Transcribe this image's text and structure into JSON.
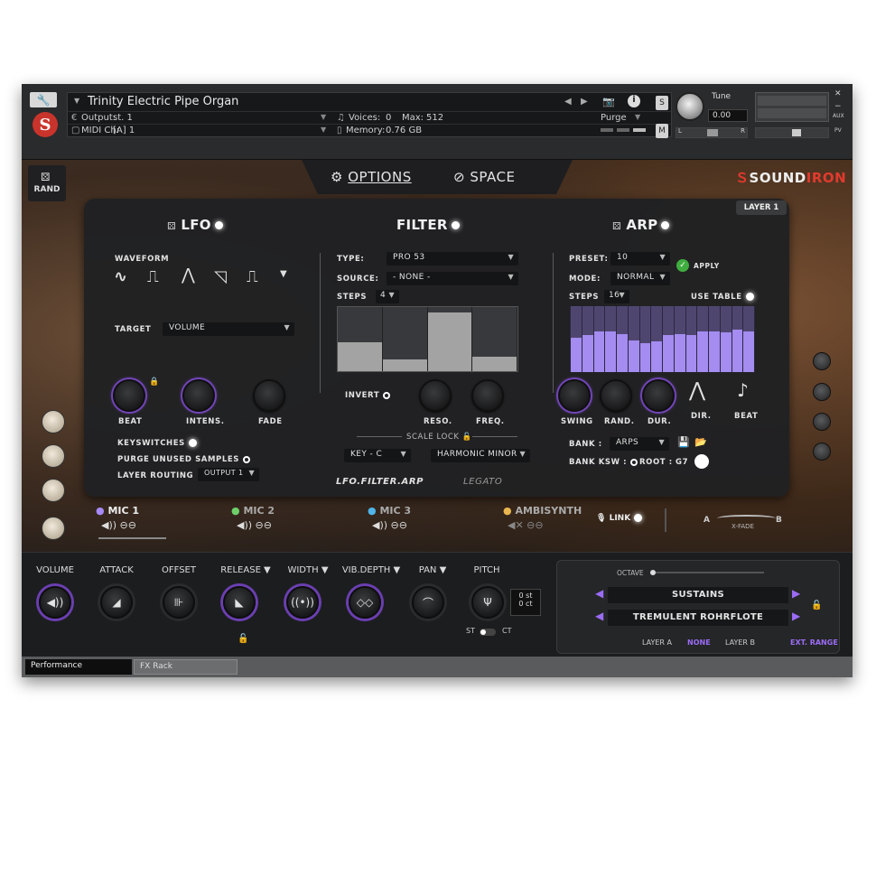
{
  "header": {
    "instrument_title": "Trinity Electric Pipe Organ",
    "output_label": "Output:",
    "output_value": "st. 1",
    "voices_label": "Voices:",
    "voices_value": "0",
    "max_label": "Max:",
    "max_value": "512",
    "purge_label": "Purge",
    "midi_label": "MIDI Ch:",
    "midi_value": "[A]  1",
    "memory_label": "Memory:",
    "memory_value": "0.76 GB",
    "tune_label": "Tune",
    "tune_value": "0.00",
    "s_label": "S",
    "m_label": "M",
    "aux_label": "AUX",
    "pv_label": "PV",
    "l_label": "L",
    "r_label": "R"
  },
  "nav": {
    "rand_label": "RAND",
    "tab_options": "OPTIONS",
    "tab_space": "SPACE",
    "brand_prefix": "SOUND",
    "brand_suffix": "IRON"
  },
  "panel": {
    "layer_badge": "LAYER 1",
    "lfo": {
      "title": "LFO",
      "waveform_label": "WAVEFORM",
      "target_label": "TARGET",
      "target_value": "VOLUME",
      "knobs": [
        "BEAT",
        "INTENS.",
        "FADE"
      ],
      "keyswitches_label": "KEYSWITCHES",
      "purge_label": "PURGE UNUSED SAMPLES",
      "routing_label": "LAYER ROUTING",
      "routing_value": "OUTPUT 1"
    },
    "filter": {
      "title": "FILTER",
      "type_label": "TYPE:",
      "type_value": "PRO 53",
      "source_label": "SOURCE:",
      "source_value": "- NONE -",
      "steps_label": "STEPS",
      "steps_value": "4",
      "step_levels": [
        0.45,
        0.18,
        0.92,
        0.22
      ],
      "invert_label": "INVERT",
      "knobs": [
        "RESO.",
        "FREQ."
      ],
      "scale_lock_label": "SCALE LOCK",
      "key_value": "KEY - C",
      "scale_value": "HARMONIC MINOR"
    },
    "arp": {
      "title": "ARP",
      "preset_label": "PRESET:",
      "preset_value": "10",
      "apply_label": "APPLY",
      "mode_label": "MODE:",
      "mode_value": "NORMAL",
      "steps_label": "STEPS",
      "steps_value": "16",
      "use_table_label": "USE TABLE",
      "step_levels": [
        0.52,
        0.56,
        0.62,
        0.62,
        0.58,
        0.48,
        0.44,
        0.46,
        0.56,
        0.58,
        0.56,
        0.62,
        0.62,
        0.6,
        0.64,
        0.62
      ],
      "knobs": [
        "SWING",
        "RAND.",
        "DUR."
      ],
      "dir_label": "DIR.",
      "beat_label": "BEAT",
      "bank_label": "BANK :",
      "bank_value": "ARPS",
      "bank_ksw_label": "BANK KSW :",
      "root_label": "ROOT :",
      "root_value": "G7"
    },
    "bottom_tabs": [
      "LFO.FILTER.ARP",
      "LEGATO"
    ]
  },
  "mics": {
    "items": [
      {
        "label": "MIC 1",
        "color": "#a78bfa"
      },
      {
        "label": "MIC 2",
        "color": "#6fcf6a"
      },
      {
        "label": "MIC 3",
        "color": "#4fb5e8"
      },
      {
        "label": "AMBISYNTH",
        "color": "#e8b64f"
      }
    ],
    "link_label": "LINK",
    "xfade_a": "A",
    "xfade_b": "B",
    "xfade_label": "X-FADE"
  },
  "controls": {
    "labels": [
      "VOLUME",
      "ATTACK",
      "OFFSET",
      "RELEASE ▼",
      "WIDTH ▼",
      "VIB.DEPTH ▼",
      "PAN ▼",
      "PITCH"
    ],
    "pitch_st": "0 st",
    "pitch_ct": "0 ct",
    "st_label": "ST",
    "ct_label": "CT",
    "octave_label": "OCTAVE",
    "articulation": "SUSTAINS",
    "patch": "TREMULENT ROHRFLOTE",
    "layer_a_label": "LAYER A",
    "layer_a_value": "NONE",
    "layer_b_label": "LAYER B",
    "ext_range_label": "EXT. RANGE"
  },
  "footer": {
    "tab_performance": "Performance",
    "tab_fx": "FX Rack"
  },
  "colors": {
    "accent": "#9b6cf5",
    "brand_red": "#e23a2e"
  }
}
